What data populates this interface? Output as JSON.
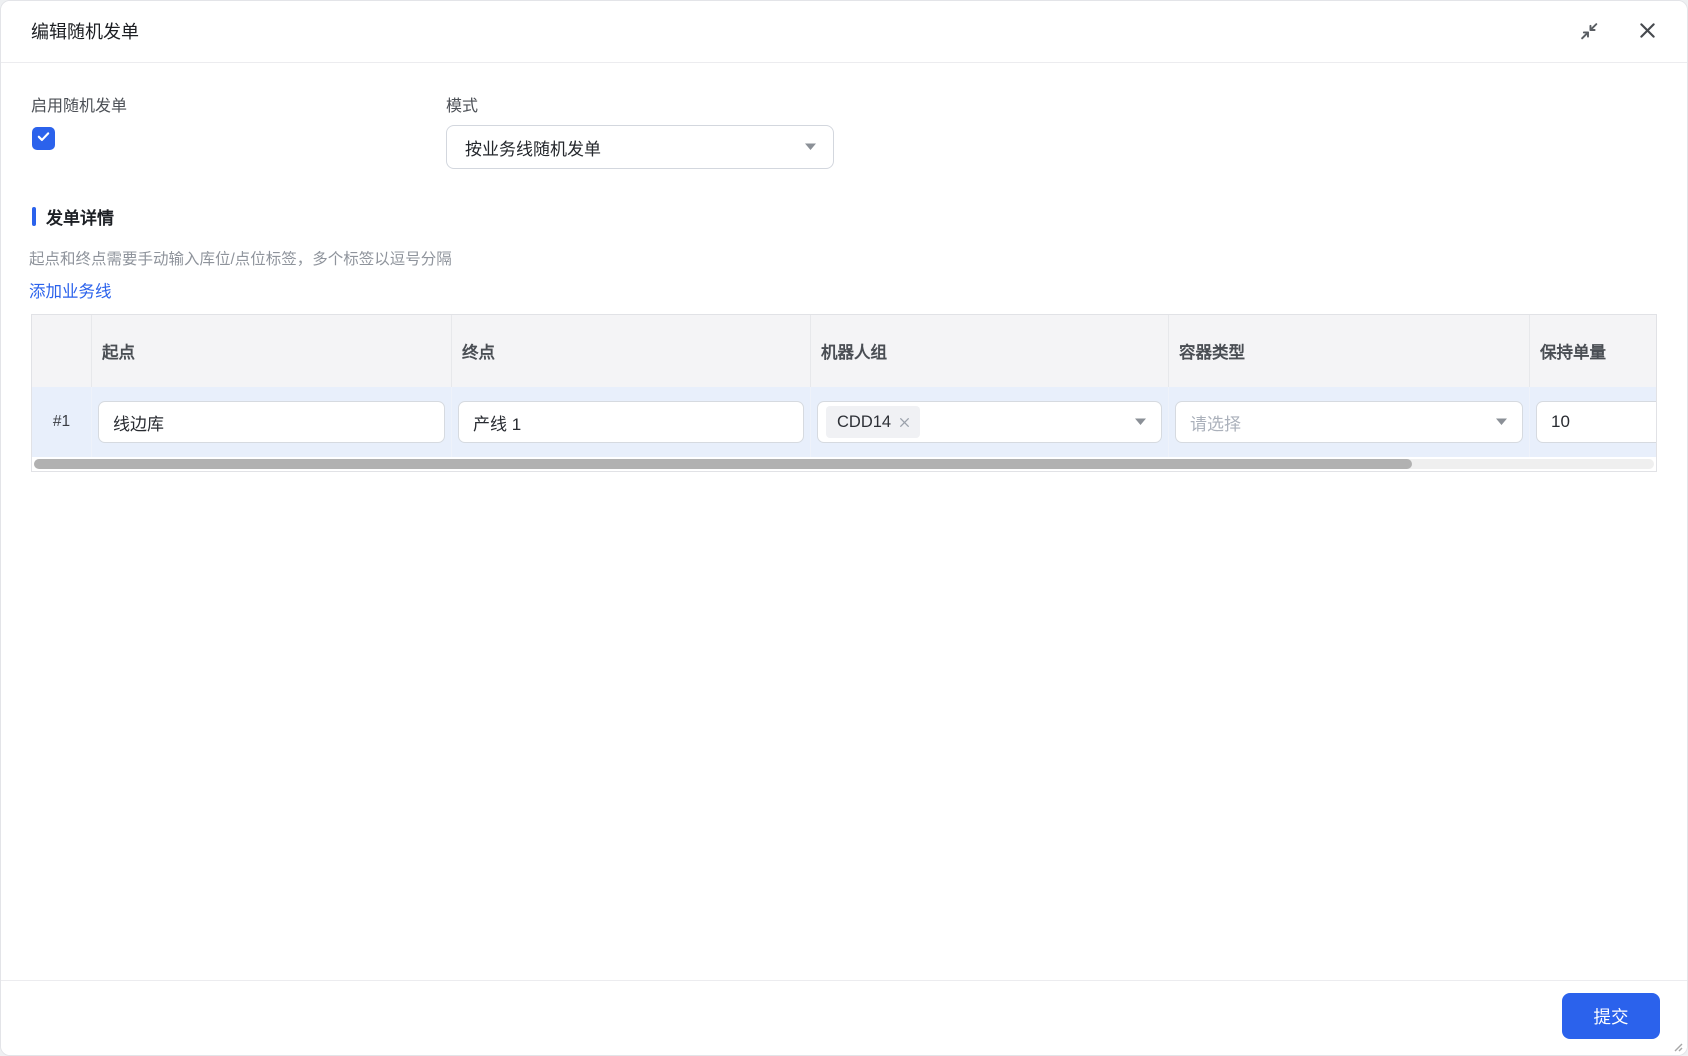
{
  "dialog": {
    "title": "编辑随机发单"
  },
  "form": {
    "enable_label": "启用随机发单",
    "enable_checked": true,
    "mode_label": "模式",
    "mode_value": "按业务线随机发单"
  },
  "section": {
    "title": "发单详情",
    "hint": "起点和终点需要手动输入库位/点位标签，多个标签以逗号分隔",
    "add_link": "添加业务线"
  },
  "table": {
    "columns": [
      "起点",
      "终点",
      "机器人组",
      "容器类型",
      "保持单量"
    ],
    "rows": [
      {
        "index": "#1",
        "start": "线边库",
        "end": "产线 1",
        "robot_groups": [
          "CDD14"
        ],
        "container_placeholder": "请选择",
        "keep_quantity": "10"
      }
    ]
  },
  "footer": {
    "submit_label": "提交"
  },
  "colors": {
    "accent": "#2b62ec",
    "row_highlight": "#e8effb",
    "header_bg": "#f4f4f6",
    "thumb": "#b1b1b1"
  }
}
